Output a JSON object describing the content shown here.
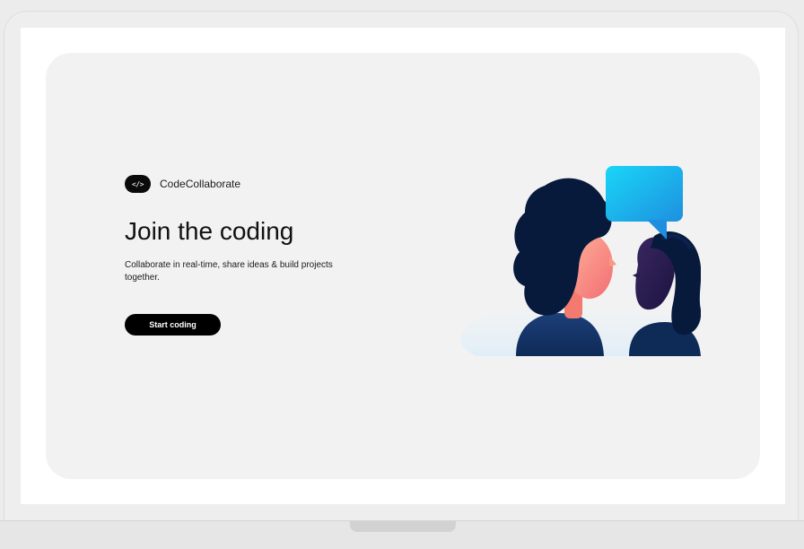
{
  "brand": {
    "badge": "</>",
    "name": "CodeCollaborate"
  },
  "hero": {
    "title": "Join the coding",
    "subtitle": "Collaborate in real-time, share ideas & build projects together.",
    "cta_label": "Start coding"
  },
  "colors": {
    "card_background": "#f2f2f2",
    "button_background": "#000000",
    "bubble_accent": "#1cc8f0"
  },
  "icons": {
    "brand": "code-brackets-icon",
    "illustration": "two-people-chatting-illustration"
  }
}
